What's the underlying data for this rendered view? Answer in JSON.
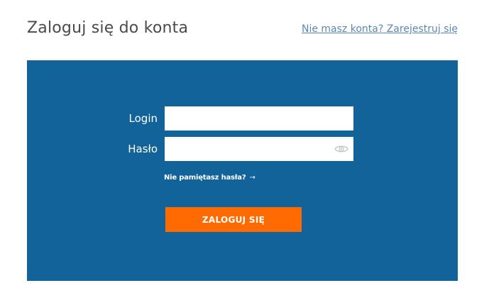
{
  "header": {
    "title": "Zaloguj się do konta",
    "register_link": "Nie masz konta? Zarejestruj się"
  },
  "form": {
    "login_label": "Login",
    "login_value": "",
    "password_label": "Hasło",
    "password_value": "",
    "forgot_password": "Nie pamiętasz hasła?",
    "forgot_arrow": "→",
    "submit_label": "ZALOGUJ SIĘ"
  },
  "colors": {
    "panel": "#12639a",
    "button": "#ff6b00",
    "link": "#5a88b5"
  },
  "icons": {
    "password_toggle": "eye-icon"
  }
}
